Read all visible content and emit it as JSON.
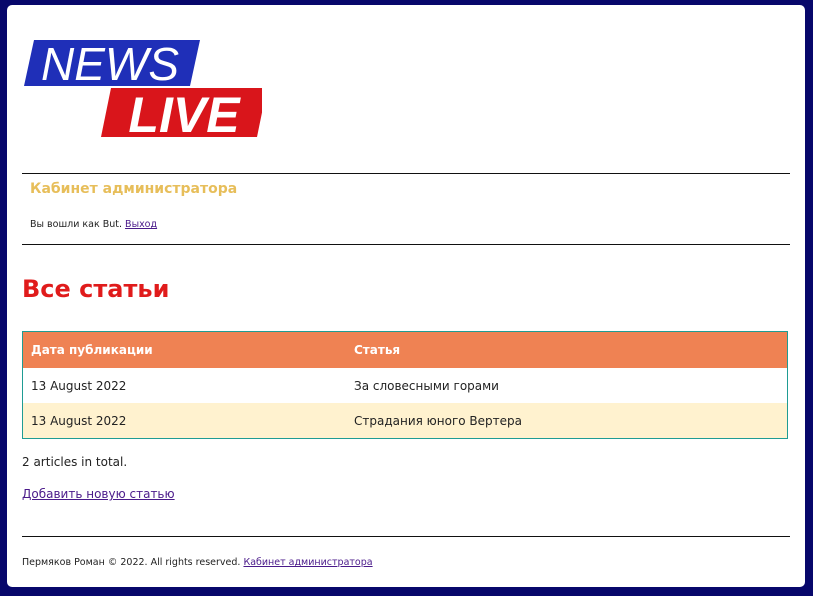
{
  "logo": {
    "line1": "NEWS",
    "line2": "LIVE"
  },
  "admin": {
    "title": "Кабинет администратора",
    "logged_in_text": "Вы вошли как But.",
    "logout_link": "Выход"
  },
  "page": {
    "heading": "Все статьи"
  },
  "table": {
    "headers": [
      "Дата публикации",
      "Статья"
    ],
    "rows": [
      {
        "date": "13 August 2022",
        "title": "За словесными горами"
      },
      {
        "date": "13 August 2022",
        "title": "Страдания юного Вертера"
      }
    ]
  },
  "summary": {
    "total": "2 articles in total."
  },
  "actions": {
    "add_article": "Добавить новую статью"
  },
  "footer": {
    "copyright": "Пермяков Роман © 2022. All rights reserved.",
    "admin_link": "Кабинет администратора"
  },
  "colors": {
    "background": "#07076b",
    "logo_blue": "#1f2fb8",
    "logo_red": "#d9151b",
    "admin_title": "#e7be5a",
    "heading": "#e01b1b",
    "table_header": "#ef8253",
    "table_border": "#1f9c93",
    "row_alt": "#fff2cf"
  }
}
